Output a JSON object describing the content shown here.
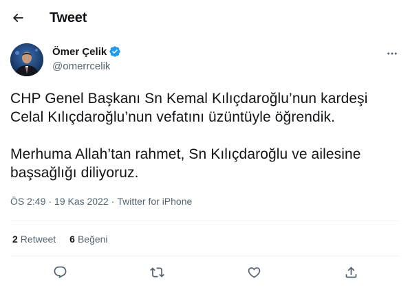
{
  "header": {
    "title": "Tweet",
    "back_icon": "arrow-left-icon"
  },
  "author": {
    "name": "Ömer Çelik",
    "handle": "@omerrcelik",
    "verified": true,
    "verified_color": "#1d9bf0",
    "avatar_icon": "profile-photo"
  },
  "tweet": {
    "paragraph1": "CHP Genel Başkanı Sn Kemal Kılıçdaroğlu’nun kardeşi Celal Kılıçdaroğlu’nun vefatını üzüntüyle öğrendik.",
    "paragraph2": "Merhuma Allah’tan rahmet, Sn Kılıçdaroğlu ve ailesine başsağlığı diliyoruz.",
    "time": "ÖS 2:49",
    "sep1": "·",
    "date": "19 Kas 2022",
    "sep2": "·",
    "source": "Twitter for iPhone"
  },
  "stats": {
    "retweets_count": "2",
    "retweets_label": "Retweet",
    "likes_count": "6",
    "likes_label": "Beğeni"
  },
  "actions": {
    "reply_icon": "reply-icon",
    "retweet_icon": "retweet-icon",
    "like_icon": "heart-icon",
    "share_icon": "share-icon"
  },
  "colors": {
    "text": "#0f1419",
    "secondary": "#536471",
    "divider": "#eff3f4",
    "accent": "#1d9bf0"
  }
}
